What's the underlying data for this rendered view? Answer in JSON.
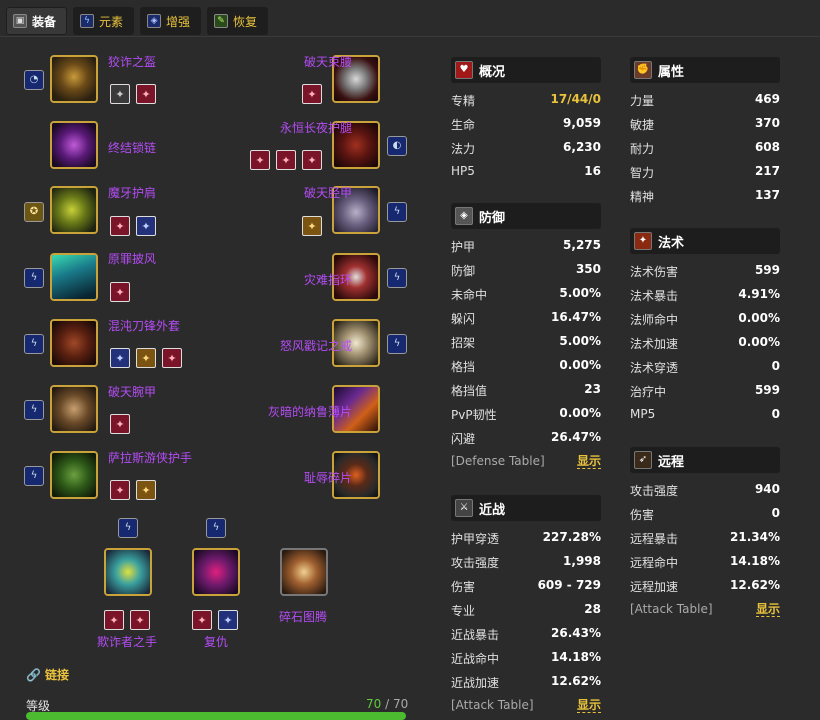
{
  "tabs": [
    {
      "label": "装备",
      "icon": "armor-icon",
      "active": true
    },
    {
      "label": "元素",
      "icon": "lightning-icon",
      "active": false
    },
    {
      "label": "增强",
      "icon": "shield-icon",
      "active": false
    },
    {
      "label": "恢复",
      "icon": "nature-icon",
      "active": false
    }
  ],
  "gear": {
    "left": [
      "狡诈之盔",
      "终结锁链",
      "魔牙护肩",
      "原罪披风",
      "混沌刀锋外套",
      "破天腕甲",
      "萨拉斯游侠护手"
    ],
    "right": [
      "破天束腰",
      "永恒长夜护腿",
      "破天胫甲",
      "灾难指环",
      "怒风戳记之戒",
      "灰暗的纳鲁薄片",
      "耻辱碎片"
    ],
    "weapons": [
      "欺诈者之手",
      "复仇",
      "碎石图腾"
    ]
  },
  "link_label": "链接",
  "level": {
    "label": "等级",
    "current": "70",
    "max": "70",
    "fraction": 1.0
  },
  "colors": {
    "item_name": "#b44cf5",
    "accent": "#e9c23c",
    "level_bar": "#4cbb30"
  },
  "panels": {
    "overview": {
      "title": "概况",
      "icon": "heart-icon",
      "rows": [
        {
          "label": "专精",
          "value": "17/44/0"
        },
        {
          "label": "生命",
          "value": "9,059"
        },
        {
          "label": "法力",
          "value": "6,230"
        },
        {
          "label": "HP5",
          "value": "16"
        }
      ]
    },
    "defense": {
      "title": "防御",
      "icon": "shield-icon",
      "rows": [
        {
          "label": "护甲",
          "value": "5,275"
        },
        {
          "label": "防御",
          "value": "350"
        },
        {
          "label": "未命中",
          "value": "5.00%"
        },
        {
          "label": "躲闪",
          "value": "16.47%"
        },
        {
          "label": "招架",
          "value": "5.00%"
        },
        {
          "label": "格挡",
          "value": "0.00%"
        },
        {
          "label": "格挡值",
          "value": "23"
        },
        {
          "label": "PvP韧性",
          "value": "0.00%"
        },
        {
          "label": "闪避",
          "value": "26.47%"
        }
      ],
      "table_label": "[Defense Table]",
      "show": "显示"
    },
    "melee": {
      "title": "近战",
      "icon": "crossed-swords-icon",
      "rows": [
        {
          "label": "护甲穿透",
          "value": "227.28%"
        },
        {
          "label": "攻击强度",
          "value": "1,998"
        },
        {
          "label": "伤害",
          "value": "609 - 729"
        },
        {
          "label": "专业",
          "value": "28"
        },
        {
          "label": "近战暴击",
          "value": "26.43%"
        },
        {
          "label": "近战命中",
          "value": "14.18%"
        },
        {
          "label": "近战加速",
          "value": "12.62%"
        }
      ],
      "table_label": "[Attack Table]",
      "show": "显示"
    },
    "attributes": {
      "title": "属性",
      "icon": "fist-icon",
      "rows": [
        {
          "label": "力量",
          "value": "469"
        },
        {
          "label": "敏捷",
          "value": "370"
        },
        {
          "label": "耐力",
          "value": "608"
        },
        {
          "label": "智力",
          "value": "217"
        },
        {
          "label": "精神",
          "value": "137"
        }
      ]
    },
    "spell": {
      "title": "法术",
      "icon": "fire-wand-icon",
      "rows": [
        {
          "label": "法术伤害",
          "value": "599"
        },
        {
          "label": "法术暴击",
          "value": "4.91%"
        },
        {
          "label": "法师命中",
          "value": "0.00%"
        },
        {
          "label": "法术加速",
          "value": "0.00%"
        },
        {
          "label": "法术穿透",
          "value": "0"
        },
        {
          "label": "治疗中",
          "value": "599"
        },
        {
          "label": "MP5",
          "value": "0"
        }
      ]
    },
    "ranged": {
      "title": "远程",
      "icon": "bow-icon",
      "rows": [
        {
          "label": "攻击强度",
          "value": "940"
        },
        {
          "label": "伤害",
          "value": "0"
        },
        {
          "label": "远程暴击",
          "value": "21.34%"
        },
        {
          "label": "远程命中",
          "value": "14.18%"
        },
        {
          "label": "远程加速",
          "value": "12.62%"
        }
      ],
      "table_label": "[Attack Table]",
      "show": "显示"
    }
  }
}
